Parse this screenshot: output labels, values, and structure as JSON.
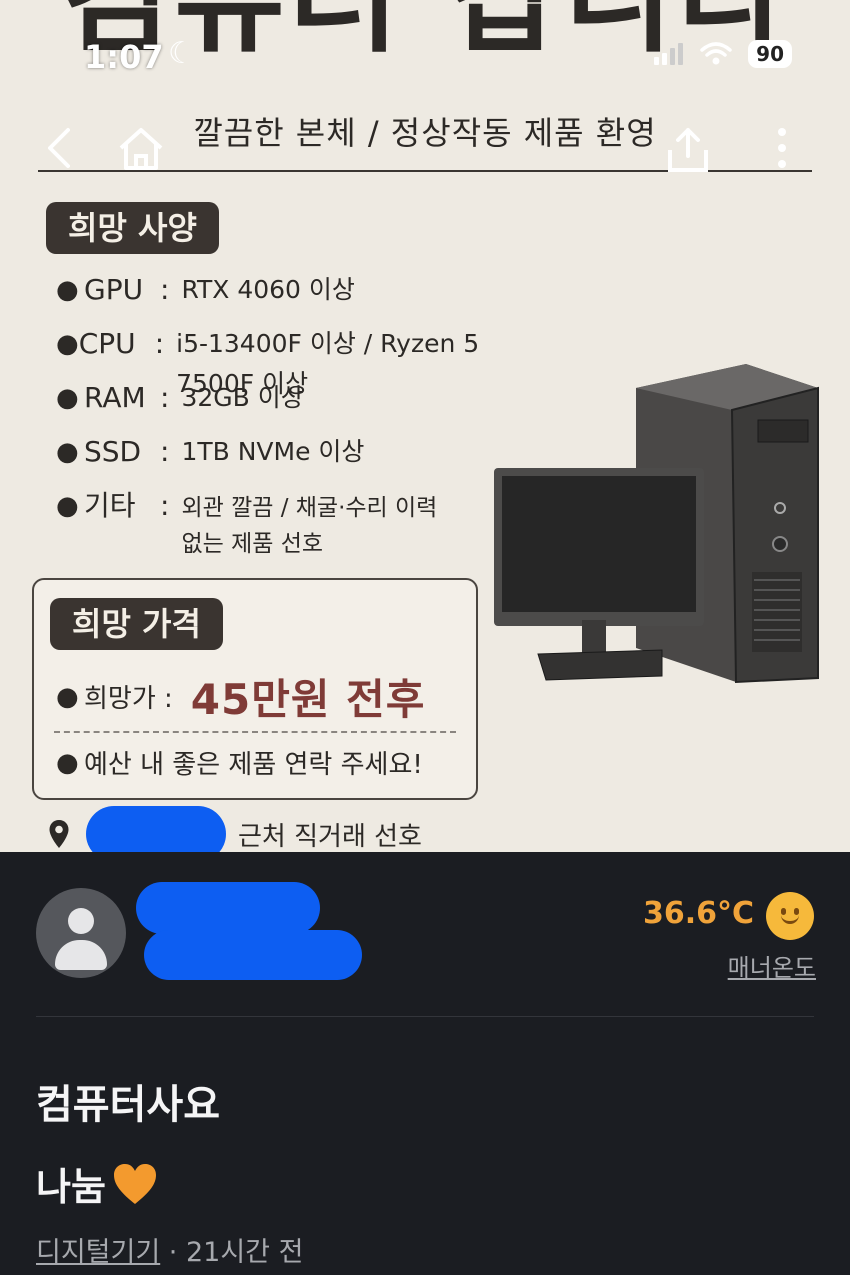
{
  "status_bar": {
    "time": "1:07",
    "battery": "90"
  },
  "poster": {
    "headline": "컴퓨터 삽니다",
    "subtitle": "깔끔한 본체 / 정상작동 제품 환영",
    "specs_heading": "희망 사양",
    "specs": [
      {
        "key": "GPU",
        "value": "RTX 4060 이상"
      },
      {
        "key": "CPU",
        "value": "i5-13400F 이상 / Ryzen 5 7500F 이상"
      },
      {
        "key": "RAM",
        "value": "32GB 이상"
      },
      {
        "key": "SSD",
        "value": "1TB NVMe 이상"
      }
    ],
    "etc": {
      "key": "기타",
      "line1": "외관 깔끔 / 채굴·수리 이력",
      "line2": "없는 제품 선호"
    },
    "price_heading": "희망 가격",
    "price_label": "희망가 :",
    "price_value": "45만원 전후",
    "price_note": "예산 내 좋은 제품 연락 주세요!",
    "location_suffix": "근처 직거래 선호"
  },
  "seller": {
    "temperature": "36.6°C",
    "manner_label": "매너온도"
  },
  "post": {
    "title": "컴퓨터사요",
    "price": "나눔",
    "category": "디지털기기",
    "time_ago": "· 21시간 전"
  },
  "colors": {
    "accent_price": "#7f3b37",
    "temperature": "#f0a33a",
    "redaction": "#0d5ef2"
  },
  "icons": [
    "back-icon",
    "home-icon",
    "share-icon",
    "more-icon",
    "location-pin-icon",
    "avatar-icon",
    "smile-face-icon",
    "heart-icon",
    "moon-icon",
    "signal-icon",
    "wifi-icon"
  ]
}
